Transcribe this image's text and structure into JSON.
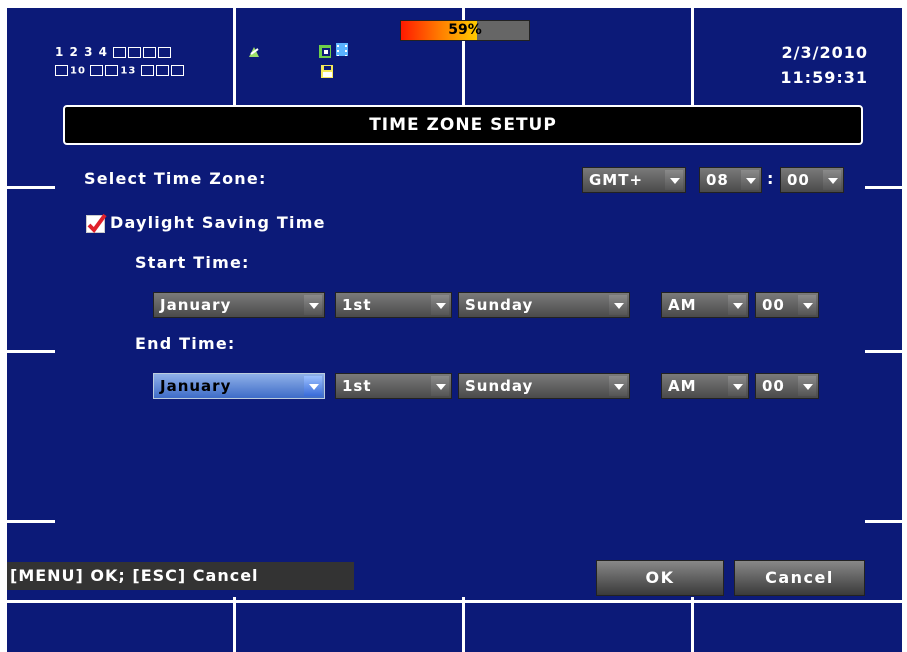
{
  "status_bar": {
    "channels_row1": [
      "1",
      "2",
      "3",
      "4"
    ],
    "channels_row2": [
      "10",
      "13"
    ],
    "disk_usage_percent": 59,
    "disk_usage_text": "59%",
    "date": "2/3/2010",
    "time": "11:59:31"
  },
  "dialog": {
    "title": "TIME ZONE SETUP",
    "select_time_zone_label": "Select Time Zone:",
    "gmt_sign": "GMT+",
    "gmt_hours": "08",
    "gmt_separator": ":",
    "gmt_minutes": "00",
    "dst_label": "Daylight Saving Time",
    "dst_checked": true,
    "start_time_label": "Start Time:",
    "start": {
      "month": "January",
      "week": "1st",
      "day": "Sunday",
      "ampm": "AM",
      "hour": "00"
    },
    "end_time_label": "End Time:",
    "end": {
      "month": "January",
      "week": "1st",
      "day": "Sunday",
      "ampm": "AM",
      "hour": "00"
    }
  },
  "footer": {
    "hint": "[MENU] OK; [ESC] Cancel",
    "ok_label": "OK",
    "cancel_label": "Cancel"
  },
  "colors": {
    "background": "#0c1a78",
    "selected_dropdown": "#3e6cc8",
    "checkbox_mark": "#e0202a"
  }
}
